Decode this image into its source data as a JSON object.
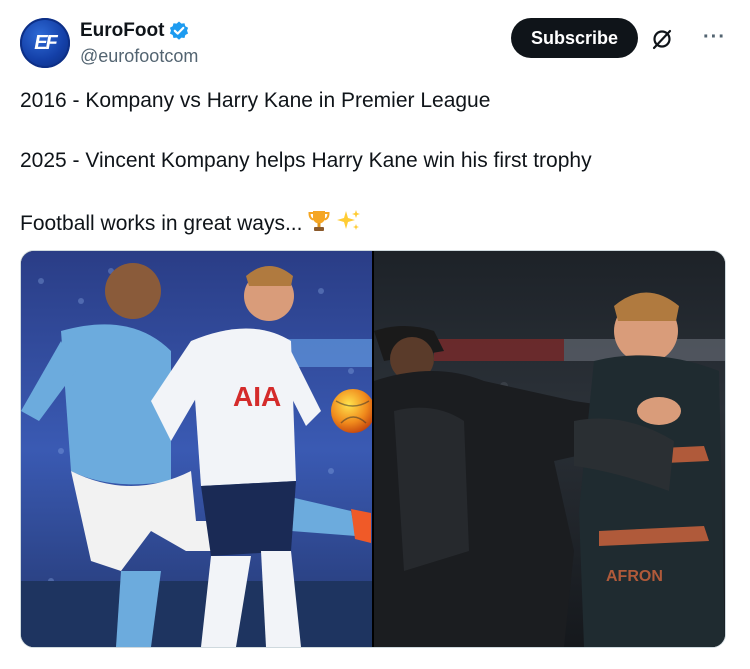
{
  "account": {
    "display_name": "EuroFoot",
    "handle": "@eurofootcom",
    "avatar_text": "EF",
    "verified": true
  },
  "actions": {
    "subscribe_label": "Subscribe",
    "grok_icon": "grok-icon",
    "more_icon": "more-icon"
  },
  "tweet": {
    "lines": [
      "2016 - Kompany vs Harry Kane in Premier League",
      "2025 - Vincent Kompany helps Harry Kane win his first trophy",
      "Football works in great ways..."
    ],
    "emojis": [
      "trophy-emoji",
      "sparkles-emoji"
    ]
  },
  "media": {
    "photo_count": 2,
    "left_shirt_text": "AIA",
    "right_shirt_text": "AFRON"
  },
  "colors": {
    "subscribe_bg": "#0f1419",
    "verified_blue": "#1d9bf0",
    "handle_gray": "#536471",
    "city_blue": "#6cabdd",
    "spurs_white": "#f2f4f8"
  }
}
